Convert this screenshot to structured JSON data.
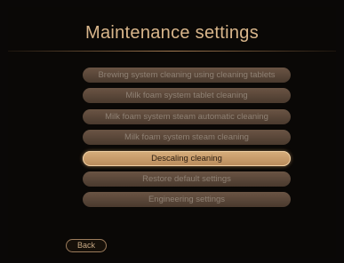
{
  "screen": {
    "title": "Maintenance settings"
  },
  "menu": {
    "items": [
      {
        "label": "Brewing system cleaning using cleaning tablets",
        "selected": false
      },
      {
        "label": "Milk foam system tablet cleaning",
        "selected": false
      },
      {
        "label": "Milk foam system steam automatic cleaning",
        "selected": false
      },
      {
        "label": "Milk foam system steam cleaning",
        "selected": false
      },
      {
        "label": "Descaling cleaning",
        "selected": true
      },
      {
        "label": "Restore default settings",
        "selected": false
      },
      {
        "label": "Engineering settings",
        "selected": false
      }
    ]
  },
  "footer": {
    "back_label": "Back"
  },
  "colors": {
    "background": "#0a0806",
    "title": "#d9b68b",
    "item_normal": "#5a4738",
    "item_selected": "#c99c69"
  }
}
